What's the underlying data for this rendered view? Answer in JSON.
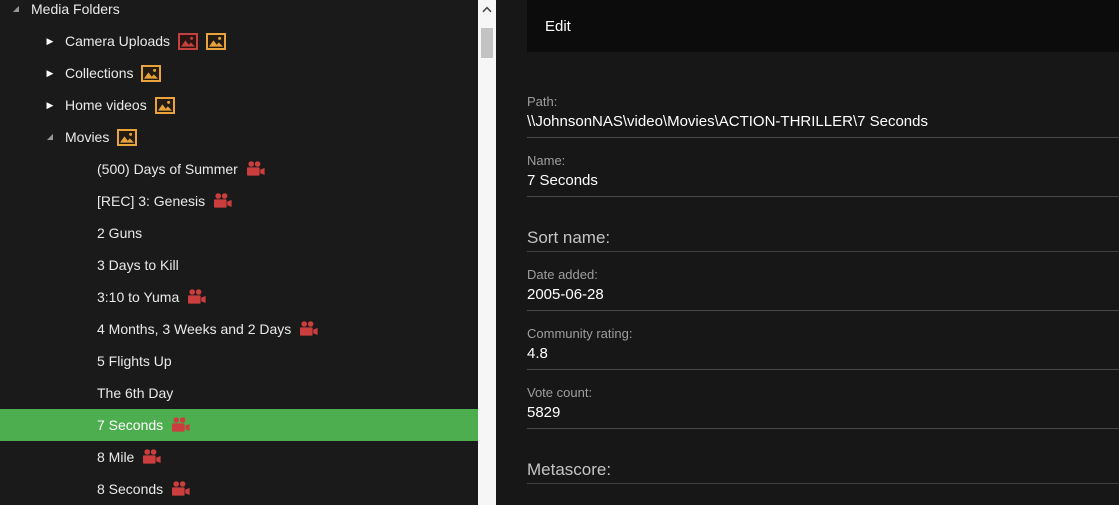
{
  "colors": {
    "selection_green": "#4cae4f",
    "camera_icon_red": "#cc3e3e",
    "image_icon_orange": "#e8a33d",
    "image_icon_orange_bg": "#241c10",
    "image_icon_red": "#c0413d",
    "image_icon_red_bg": "#2b1312"
  },
  "tree": {
    "rows": [
      {
        "label": "Media Folders",
        "level": 0,
        "expander": "open",
        "icons": [],
        "selected": false
      },
      {
        "label": "Camera Uploads",
        "level": 1,
        "expander": "closed",
        "icons": [
          "image-red",
          "image-orange"
        ],
        "selected": false
      },
      {
        "label": "Collections",
        "level": 1,
        "expander": "closed",
        "icons": [
          "image-orange"
        ],
        "selected": false
      },
      {
        "label": "Home videos",
        "level": 1,
        "expander": "closed",
        "icons": [
          "image-orange"
        ],
        "selected": false
      },
      {
        "label": "Movies",
        "level": 1,
        "expander": "open",
        "icons": [
          "image-orange"
        ],
        "selected": false
      },
      {
        "label": "(500) Days of Summer",
        "level": 2,
        "expander": "none",
        "icons": [
          "camera"
        ],
        "selected": false
      },
      {
        "label": "[REC] 3: Genesis",
        "level": 2,
        "expander": "none",
        "icons": [
          "camera"
        ],
        "selected": false
      },
      {
        "label": "2 Guns",
        "level": 2,
        "expander": "none",
        "icons": [],
        "selected": false
      },
      {
        "label": "3 Days to Kill",
        "level": 2,
        "expander": "none",
        "icons": [],
        "selected": false
      },
      {
        "label": "3:10 to Yuma",
        "level": 2,
        "expander": "none",
        "icons": [
          "camera"
        ],
        "selected": false
      },
      {
        "label": "4 Months, 3 Weeks and 2 Days",
        "level": 2,
        "expander": "none",
        "icons": [
          "camera"
        ],
        "selected": false
      },
      {
        "label": "5 Flights Up",
        "level": 2,
        "expander": "none",
        "icons": [],
        "selected": false
      },
      {
        "label": "The 6th Day",
        "level": 2,
        "expander": "none",
        "icons": [],
        "selected": false
      },
      {
        "label": "7 Seconds",
        "level": 2,
        "expander": "none",
        "icons": [
          "camera"
        ],
        "selected": true
      },
      {
        "label": "8 Mile",
        "level": 2,
        "expander": "none",
        "icons": [
          "camera"
        ],
        "selected": false
      },
      {
        "label": "8 Seconds",
        "level": 2,
        "expander": "none",
        "icons": [
          "camera"
        ],
        "selected": false
      }
    ]
  },
  "editor": {
    "tab_label": "Edit",
    "fields": [
      {
        "label": "Path:",
        "value": "\\\\JohnsonNAS\\video\\Movies\\ACTION-THRILLER\\7 Seconds",
        "style": "filled"
      },
      {
        "label": "Name:",
        "value": "7 Seconds",
        "style": "filled"
      },
      {
        "label": "Sort name:",
        "value": "",
        "style": "empty"
      },
      {
        "label": "Date added:",
        "value": "2005-06-28",
        "style": "filled"
      },
      {
        "label": "Community rating:",
        "value": "4.8",
        "style": "filled"
      },
      {
        "label": "Vote count:",
        "value": "5829",
        "style": "filled"
      },
      {
        "label": "Metascore:",
        "value": "",
        "style": "empty"
      }
    ]
  }
}
